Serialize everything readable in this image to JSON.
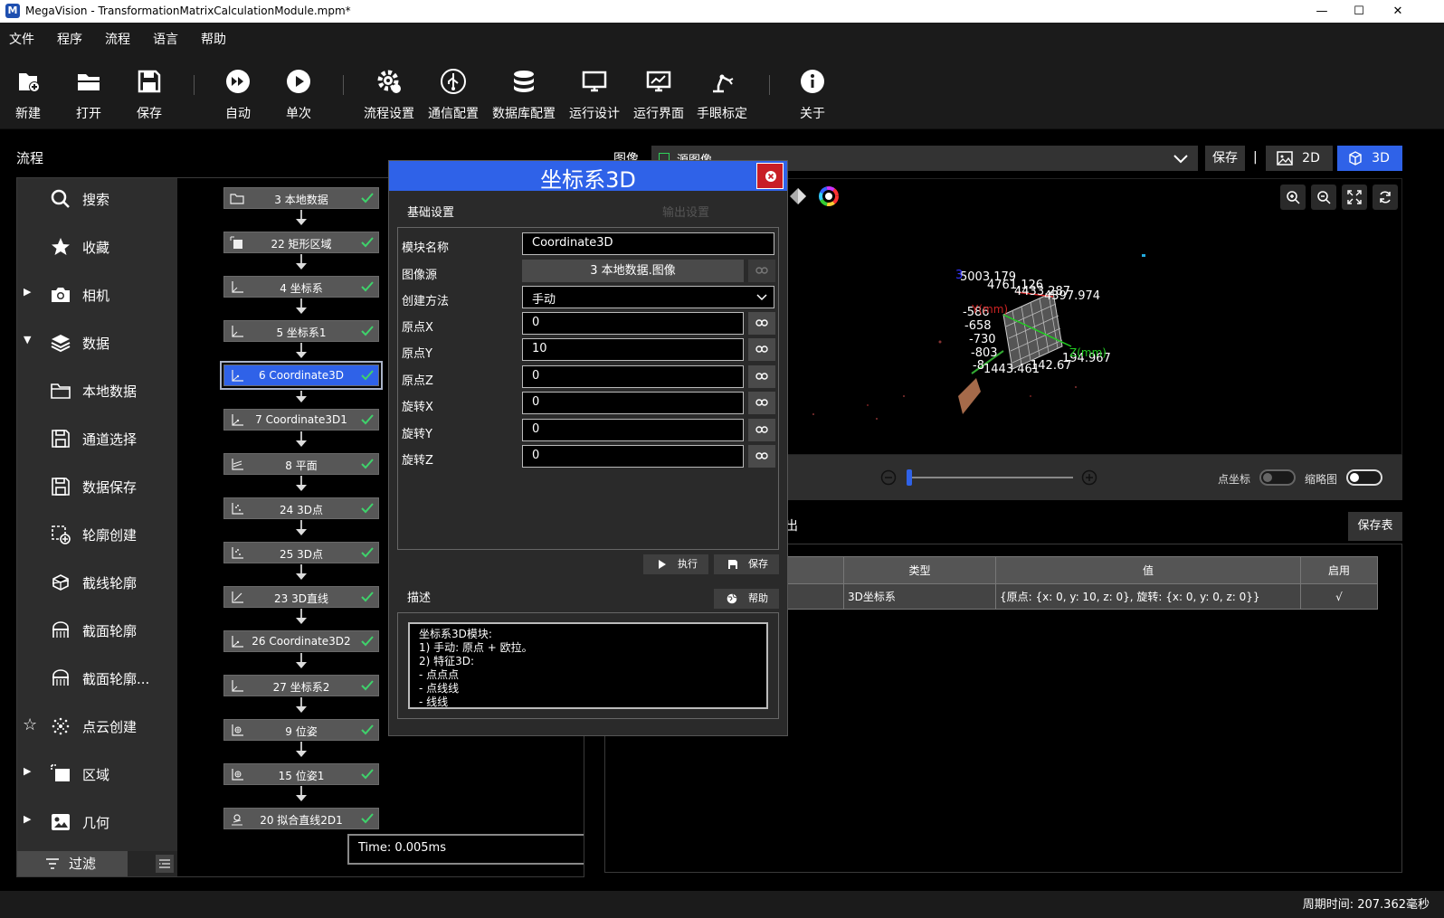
{
  "window": {
    "app_letter": "M",
    "title": "MegaVision - TransformationMatrixCalculationModule.mpm*",
    "minimize": "—",
    "maximize": "☐",
    "close": "✕"
  },
  "menu": [
    "文件",
    "程序",
    "流程",
    "语言",
    "帮助"
  ],
  "toolbar": {
    "new": "新建",
    "open": "打开",
    "save": "保存",
    "auto": "自动",
    "single": "单次",
    "flow_settings": "流程设置",
    "comm_config": "通信配置",
    "db_config": "数据库配置",
    "run_design": "运行设计",
    "run_ui": "运行界面",
    "hand_eye": "手眼标定",
    "about": "关于"
  },
  "flow_panel": {
    "title": "流程",
    "time": "Time: 0.005ms"
  },
  "sidebar": {
    "items": [
      {
        "label": "搜索",
        "icon": "search-icon"
      },
      {
        "label": "收藏",
        "icon": "star-icon"
      },
      {
        "label": "相机",
        "icon": "camera-icon",
        "arrow": "▶"
      },
      {
        "label": "数据",
        "icon": "layers-icon",
        "arrow": "▼"
      },
      {
        "label": "本地数据",
        "icon": "folder-icon"
      },
      {
        "label": "通道选择",
        "icon": "save-icon"
      },
      {
        "label": "数据保存",
        "icon": "save-icon"
      },
      {
        "label": "轮廓创建",
        "icon": "contour-icon"
      },
      {
        "label": "截线轮廓",
        "icon": "cube-cut-icon"
      },
      {
        "label": "截面轮廓",
        "icon": "section-icon"
      },
      {
        "label": "截面轮廓...",
        "icon": "section-icon"
      },
      {
        "label": "点云创建",
        "icon": "pointcloud-icon",
        "star": "☆"
      },
      {
        "label": "区域",
        "icon": "region-icon",
        "arrow": "▶"
      },
      {
        "label": "几何",
        "icon": "geometry-icon",
        "arrow": "▶"
      }
    ],
    "filter": "过滤"
  },
  "nodes": [
    "3 本地数据",
    "22 矩形区域",
    "4 坐标系",
    "5 坐标系1",
    "6 Coordinate3D",
    "7 Coordinate3D1",
    "8 平面",
    "24 3D点",
    "25 3D点",
    "23 3D直线",
    "26 Coordinate3D2",
    "27 坐标系2",
    "9 位姿",
    "15 位姿1",
    "20 拟合直线2D1"
  ],
  "image_panel": {
    "label": "图像",
    "source": "源图像",
    "save": "保存",
    "sep": "|",
    "btn_2d": "2D",
    "btn_3d": "3D",
    "point_coord": "点坐标",
    "thumbnail": "缩略图"
  },
  "viewer_labels": {
    "l1": "5003.179",
    "l2": "4761.126",
    "l3": "4433.287",
    "l4": "4397.974",
    "l5": "-586",
    "l6": "-658",
    "l7": "-730",
    "l8": "-803",
    "l9": "-8",
    "l10": "1443.461",
    "l11": "142.67",
    "l12": "194.967",
    "l13": "3",
    "l14": "Y(mm)",
    "l15": "Z(mm)"
  },
  "table": {
    "title": "出",
    "save_table": "保存表",
    "headers": [
      "类型",
      "值",
      "启用"
    ],
    "rows": [
      [
        "3D坐标系",
        "{原点: {x: 0, y: 10, z: 0}, 旋转: {x: 0, y: 0, z: 0}}",
        "√"
      ]
    ]
  },
  "dialog": {
    "title": "坐标系3D",
    "tab_basic": "基础设置",
    "tab_output": "输出设置",
    "fields": {
      "module_name_label": "模块名称",
      "module_name": "Coordinate3D",
      "image_source_label": "图像源",
      "image_source": "3 本地数据.图像",
      "create_method_label": "创建方法",
      "create_method": "手动",
      "origin_x_label": "原点X",
      "origin_x": "0",
      "origin_y_label": "原点Y",
      "origin_y": "10",
      "origin_z_label": "原点Z",
      "origin_z": "0",
      "rot_x_label": "旋转X",
      "rot_x": "0",
      "rot_y_label": "旋转Y",
      "rot_y": "0",
      "rot_z_label": "旋转Z",
      "rot_z": "0"
    },
    "execute": "执行",
    "save": "保存",
    "desc_label": "描述",
    "help": "帮助",
    "desc_lines": [
      "坐标系3D模块:",
      "1) 手动: 原点 + 欧拉。",
      "2) 特征3D:",
      "- 点点点",
      "- 点线线",
      "- 线线"
    ]
  },
  "status": {
    "cycle": "周期时间: 207.362毫秒"
  }
}
